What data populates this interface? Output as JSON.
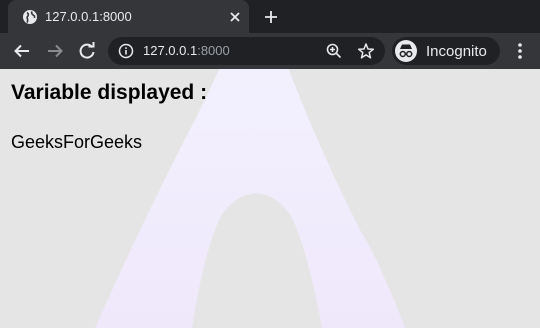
{
  "browser": {
    "tab": {
      "title": "127.0.0.1:8000"
    },
    "omnibox": {
      "url_host": "127.0.0.1",
      "url_port": ":8000"
    },
    "profile": {
      "label": "Incognito"
    }
  },
  "page": {
    "heading": "Variable displayed :",
    "text": "GeeksForGeeks"
  },
  "colors": {
    "tab_strip": "#202124",
    "toolbar": "#35363a",
    "page_background": "#e5e5e5"
  },
  "icons": {
    "favicon": "globe-icon",
    "close": "close-icon",
    "new_tab": "plus-icon",
    "back": "back-arrow-icon",
    "forward": "forward-arrow-icon",
    "reload": "reload-icon",
    "site_info": "info-icon",
    "zoom": "zoom-icon",
    "bookmark": "star-icon",
    "profile": "incognito-icon",
    "menu": "kebab-menu-icon"
  }
}
